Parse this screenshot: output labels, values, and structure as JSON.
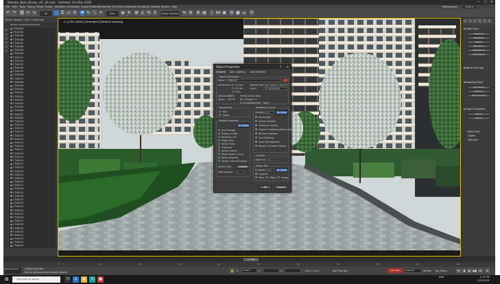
{
  "window": {
    "title": "Meadow_Base_Blocks_v07_4b.max - Autodesk 3ds Max 2018",
    "controls": [
      "—",
      "□",
      "✕"
    ]
  },
  "menu": {
    "items": [
      "File",
      "Edit",
      "Tools",
      "Group",
      "Views",
      "Create",
      "Modifiers",
      "Animation",
      "Graph Editors",
      "Rendering",
      "Civil View",
      "Customize",
      "Scripting",
      "Content",
      "Arnold",
      "Help"
    ],
    "workspace_label": "Workspaces:",
    "workspace_value": "Default"
  },
  "toolbar": {
    "selection_filter": "All",
    "view_mode": "View",
    "selection_set": "Create Selection Se"
  },
  "explorer": {
    "tabs": [
      "Select",
      "Display",
      "Edit",
      "Customize"
    ],
    "header": "Name (Sorted Ascending)",
    "rows": [
      "CTN0183",
      "CTN0184",
      "CTN0185",
      "CTN0186",
      "CTN0187",
      "CTN0188",
      "CTN0189",
      "CTN0190",
      "CTN0191",
      "CTN0192",
      "CTN0193",
      "CTN0194",
      "CTN0195",
      "CTN0196",
      "CTN0197",
      "CTN0198",
      "CTN0199",
      "CTN0200",
      "CTN0201",
      "CTN0202",
      "CTN0203",
      "CTN0204",
      "CTN0205",
      "CTN0206",
      "CTN0207",
      "CTN0208",
      "CTN0209",
      "CTN0210",
      "CTN0211",
      "CTN0212",
      "CTN0213",
      "CTN0214",
      "CTN0215",
      "CTN0216",
      "CTN0217",
      "CTN0218",
      "CTN0219",
      "CTN0220",
      "CTN0221",
      "CTN0222",
      "CTN0223",
      "CTN0224",
      "CTN0225",
      "CTN0226",
      "CTN0227",
      "CTN0228",
      "CTN0229",
      "CTN0230",
      "CTN0231",
      "CTN0232",
      "CTN0233",
      "CTN0234",
      "CTN0235",
      "CTN0236",
      "CTN0237",
      "CTN0238",
      "CTN0239",
      "CTN0240",
      "CTN0241",
      "CTN0242",
      "CTN0243",
      "CTN0244"
    ]
  },
  "viewport": {
    "label": "[+] [VR-CAM01] [Standard] [Default Shading]"
  },
  "dialog": {
    "title": "Object Properties",
    "close": "✕",
    "help": "?",
    "tabs": [
      "General",
      "Adv. Lighting",
      "User Defined"
    ],
    "object_info": {
      "group": "Object Information",
      "name_label": "Name:",
      "name_value": "CTN0195",
      "dimensions_label": "Dimensions:",
      "x": "X: 0.341m",
      "y": "Y: 0.214m",
      "z": "Z: 0.0m",
      "material_name_label": "Material Name:",
      "material_name_value": "Tree_Canopy_Leaf_01",
      "layer_label": "Layer:",
      "layer_value": "11_Landscape",
      "vertices_label": "Vertices:",
      "vertices_value": "86674",
      "faces_label": "Faces:",
      "faces_value": "45176",
      "parent_label": "Parent:",
      "parent_value": "Scene Root",
      "num_children_label": "No. Children:",
      "num_children_value": "0",
      "in_group_label": "In Group/Assembly:",
      "in_group_value": "None"
    },
    "interactivity": {
      "group": "Interactivity",
      "hide": "Hide",
      "freeze": "Freeze"
    },
    "display_properties": {
      "group": "Display Properties",
      "by_object": "By Object",
      "options": [
        "See-Through",
        "Display as Box",
        "Backface Cull",
        "Edges Only",
        "Vertex Ticks",
        "Trajectory",
        "Ignore Extents",
        "Show Frozen in Gray",
        "Never Degrade",
        "Vertex Channel Display"
      ],
      "vertex_color": "Vertex Color",
      "shaded": "Shaded",
      "map_channel": "Map Channel:",
      "map_channel_value": "1"
    },
    "rendering_control": {
      "group": "Rendering Control",
      "visibility_label": "Visibility:",
      "visibility_value": "1.0",
      "by_layer": "By Layer",
      "options": [
        "Renderable",
        "Inherit Visibility",
        "Visible to Camera",
        "Visible to Reflection/Refraction",
        "Receive Shadows",
        "Cast Shadows",
        "Apply Atmospherics",
        "Render Occluded Objects"
      ]
    },
    "g_buffer": {
      "group": "G-Buffer",
      "object_id_label": "Object ID:",
      "object_id_value": "0"
    },
    "motion_blur": {
      "group": "Motion Blur",
      "multiplier_label": "Multiplier:",
      "multiplier_value": "1.0",
      "by_object": "By Object",
      "enabled": "Enabled",
      "none": "None",
      "object": "Object",
      "image": "Image"
    },
    "ok": "OK",
    "cancel": "Cancel"
  },
  "command_panel": {
    "sections": [
      {
        "title": "Object Type",
        "buttons": [
          "AutoGrid",
          "VRayProxy",
          "VRayFur",
          "VRayPlane",
          "VRaySphere",
          "VRayClipper"
        ]
      },
      {
        "title": "Name and Color",
        "buttons": []
      },
      {
        "title": "Modeling Panel",
        "buttons": [
          "Grid Points",
          "Edit Poly",
          "Mesh Smooth"
        ]
      },
      {
        "title": "Object Transform",
        "buttons": [
          "Detach",
          "Attach"
        ]
      }
    ],
    "checks": [
      "Keep Pivot",
      "Object",
      "Selected"
    ]
  },
  "timeline": {
    "slider": "0 / 100",
    "ticks": [
      "0",
      "10",
      "20",
      "30",
      "40",
      "50",
      "60",
      "70",
      "80",
      "90",
      "100"
    ]
  },
  "status": {
    "maxscript": "MAXScript Mi",
    "line1": "1 Object Selected",
    "line2": "Click or click-and-drag to select objects",
    "x_label": "X:",
    "x_value": "2.554m",
    "y_label": "Y:",
    "y_value": "",
    "z_label": "Z:",
    "z_value": "",
    "grid": "Grid = 0.1m",
    "add_time_tag": "Add Time Tag",
    "auto_key": "Auto Key",
    "selected": "Selected",
    "set_key": "Set Key",
    "key_filters": "Key Filters..."
  },
  "taskbar": {
    "search_placeholder": "Type here to search",
    "tray_time": "2:15 PM",
    "tray_date": "2/23/2018",
    "tray_lang": "ENG"
  },
  "colors": {
    "app_bg": "#3a3a3a",
    "accent": "#3e6fb0",
    "name_swatch": "#d13a35",
    "viewport_border": "#e8c200",
    "auto_key": "#b03030"
  }
}
